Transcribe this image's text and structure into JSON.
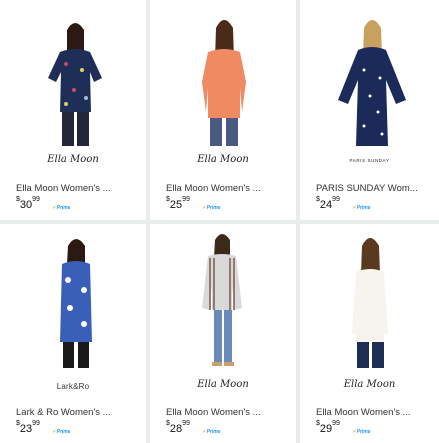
{
  "products": [
    {
      "brand": "Ella Moon",
      "title": "Ella Moon Women's ...",
      "price_whole": "30",
      "price_frac": "99",
      "price_symbol": "$",
      "prime_label": "Prime",
      "shirt_color": "#1f2e57"
    },
    {
      "brand": "Ella Moon",
      "title": "Ella Moon Women's ...",
      "price_whole": "25",
      "price_frac": "99",
      "price_symbol": "$",
      "prime_label": "Prime",
      "shirt_color": "#f08a62"
    },
    {
      "brand": "PARIS SUNDAY",
      "title": "PARIS SUNDAY Wom...",
      "price_whole": "24",
      "price_frac": "99",
      "price_symbol": "$",
      "prime_label": "Prime",
      "shirt_color": "#1c2a5a"
    },
    {
      "brand": "Lark&Ro",
      "title": "Lark & Ro Women's ...",
      "price_whole": "23",
      "price_frac": "99",
      "price_symbol": "$",
      "prime_label": "Prime",
      "shirt_color": "#3a5fb8"
    },
    {
      "brand": "Ella Moon",
      "title": "Ella Moon Women's ...",
      "price_whole": "28",
      "price_frac": "99",
      "price_symbol": "$",
      "prime_label": "Prime",
      "shirt_color": "#d9d9d9"
    },
    {
      "brand": "Ella Moon",
      "title": "Ella Moon Women's ...",
      "price_whole": "29",
      "price_frac": "99",
      "price_symbol": "$",
      "prime_label": "Prime",
      "shirt_color": "#f7f4ee"
    }
  ],
  "colors": {
    "background": "#eaeded",
    "card": "#ffffff",
    "prime_blue": "#1a98ff",
    "text": "#333333"
  }
}
